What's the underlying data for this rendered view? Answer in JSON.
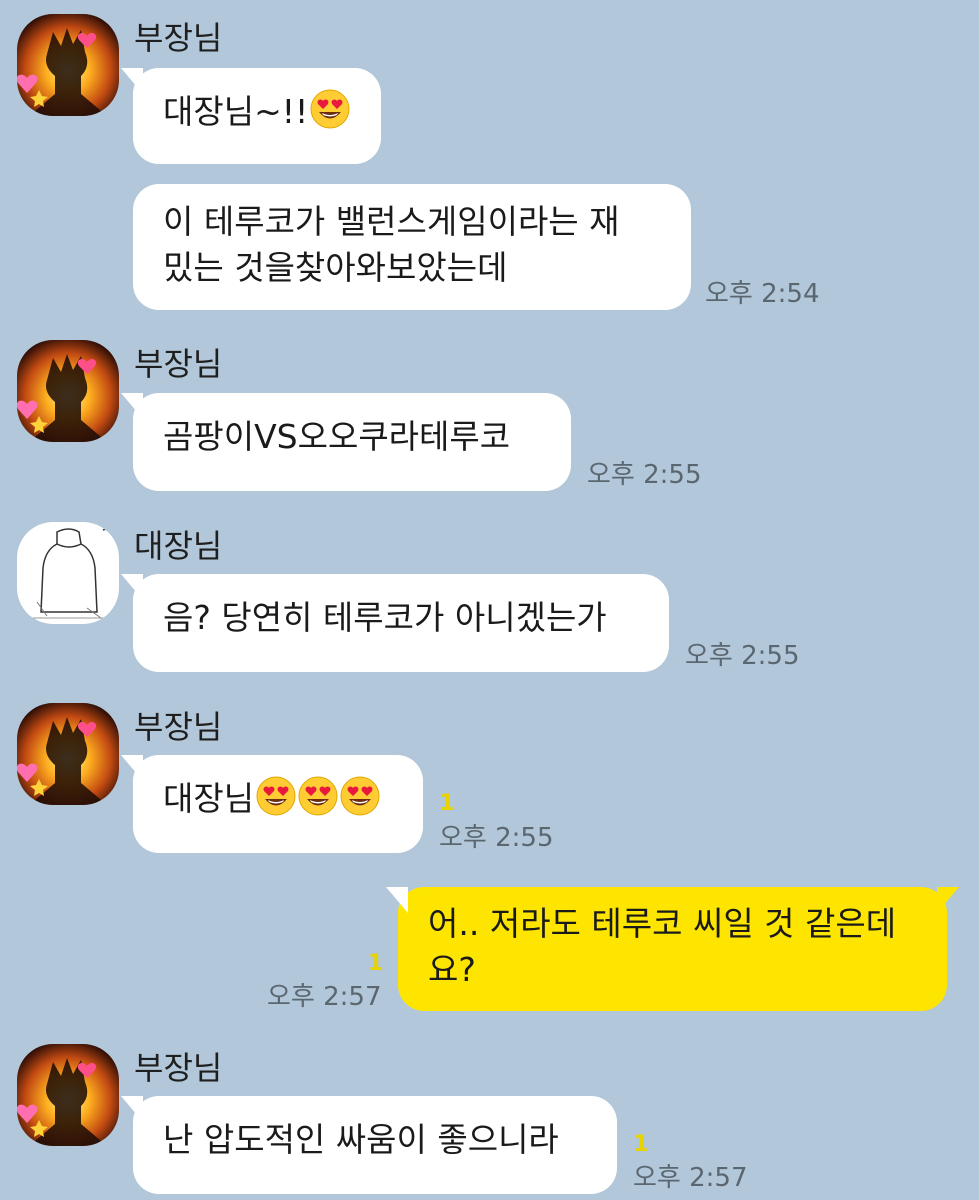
{
  "chat": {
    "messages": [
      {
        "sender": "부장님",
        "text": "대장님~!!",
        "emoji_count": 1
      },
      {
        "line1": "이 테루코가 밸런스게임이라는 재",
        "line2": "밌는 것을찾아와보았는데",
        "time": "오후 2:54"
      },
      {
        "sender": "부장님",
        "text": "곰팡이VS오오쿠라테루코",
        "time": "오후 2:55"
      },
      {
        "sender": "대장님",
        "text": "음? 당연히 테루코가 아니겠는가",
        "time": "오후 2:55"
      },
      {
        "sender": "부장님",
        "text": "대장님",
        "emoji_count": 3,
        "unread": "1",
        "time": "오후 2:55"
      },
      {
        "line1": "어.. 저라도 테루코 씨일 것 같은데",
        "line2": "요?",
        "unread": "1",
        "time": "오후 2:57"
      },
      {
        "sender": "부장님",
        "text": "난 압도적인 싸움이 좋으니라",
        "unread": "1",
        "time": "오후 2:57"
      }
    ]
  },
  "colors": {
    "background": "#b2c7d9",
    "bubble_other": "#ffffff",
    "bubble_mine": "#fee500",
    "unread_count": "#e8d200",
    "timestamp": "#5b6770"
  },
  "icons": {
    "avatar_bujangnim": "anime-character-avatar-with-hearts",
    "avatar_daejangnim": "sketch-character-avatar",
    "emoji": "heart-eyes-emoji"
  }
}
